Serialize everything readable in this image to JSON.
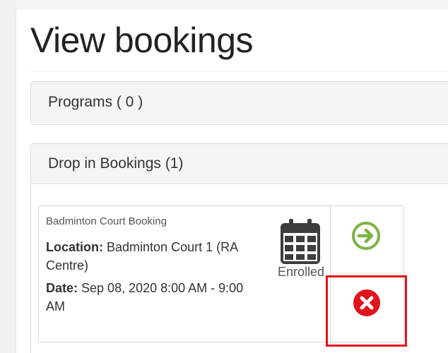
{
  "page": {
    "title": "View bookings"
  },
  "panels": {
    "programs_heading": "Programs ( 0 )",
    "dropin_heading": "Drop in Bookings (1)"
  },
  "booking": {
    "name": "Badminton Court Booking",
    "location_label": "Location:",
    "location_value": "Badminton Court 1 (RA Centre)",
    "date_label": "Date:",
    "date_value": "Sep 08, 2020 8:00 AM - 9:00 AM",
    "status": "Enrolled"
  },
  "icons": {
    "calendar": "calendar-icon",
    "go": "arrow-right-circle-icon",
    "cancel": "x-circle-icon"
  },
  "colors": {
    "go_green": "#7cb342",
    "cancel_red": "#e0141b",
    "calendar_dark": "#3d3d3d",
    "highlight_red": "#e0141b"
  }
}
